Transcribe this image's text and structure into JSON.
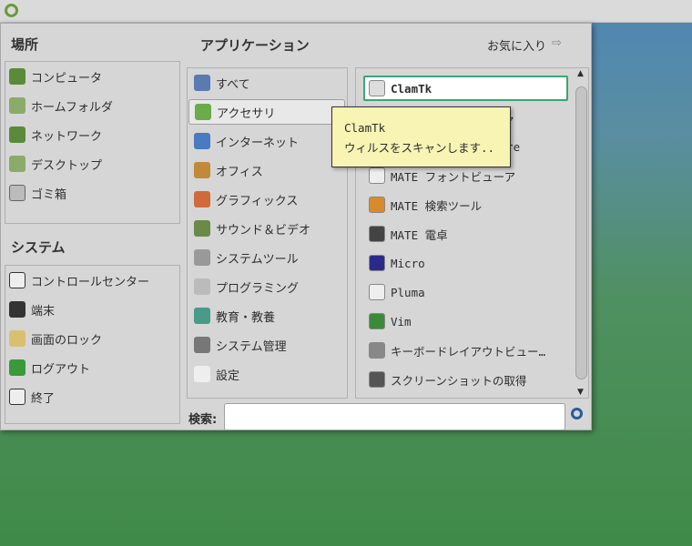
{
  "panel": {
    "logo": "mate-menu-logo"
  },
  "places": {
    "title": "場所",
    "items": [
      "コンピュータ",
      "ホームフォルダ",
      "ネットワーク",
      "デスクトップ",
      "ゴミ箱"
    ]
  },
  "system": {
    "title": "システム",
    "items": [
      "コントロールセンター",
      "端末",
      "画面のロック",
      "ログアウト",
      "終了"
    ]
  },
  "apps": {
    "title": "アプリケーション",
    "favorites": "お気に入り",
    "categories": [
      "すべて",
      "アクセサリ",
      "インターネット",
      "オフィス",
      "グラフィックス",
      "サウンド＆ビデオ",
      "システムツール",
      "プログラミング",
      "教育・教養",
      "システム管理",
      "設定"
    ],
    "items": [
      "ClamTk",
      "ジャ",
      "core",
      "MATE フォントビューア",
      "MATE 検索ツール",
      "MATE 電卓",
      "Micro",
      "Pluma",
      "Vim",
      "キーボードレイアウトビュー…",
      "スクリーンショットの取得"
    ]
  },
  "search": {
    "label": "検索:",
    "value": ""
  },
  "tooltip": {
    "title": "ClamTk",
    "text": "ウィルスをスキャンします.."
  }
}
